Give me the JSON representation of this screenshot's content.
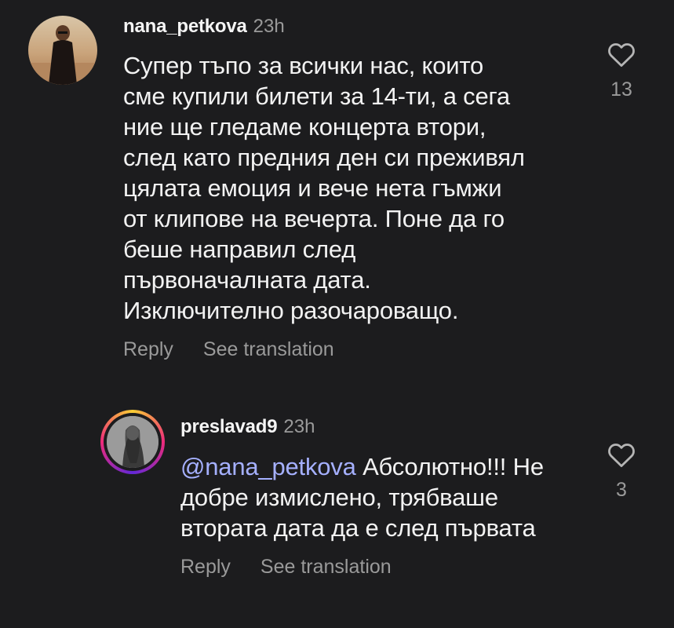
{
  "comments": [
    {
      "username": "nana_petkova",
      "time": "23h",
      "text": "Супер тъпо за всички нас, които\nсме купили билети за 14-ти, а сега\nние ще гледаме концерта втори,\nслед като предния ден си преживял\nцялата емоция и вече нета гъмжи\nот клипове на вечерта. Поне да го\nбеше направил след\nпървоначалната дата.\nИзключително разочароващо.",
      "reply_label": "Reply",
      "translate_label": "See translation",
      "likes": "13",
      "icon": "heart-outline-icon"
    },
    {
      "username": "preslavad9",
      "time": "23h",
      "mention": "@nana_petkova",
      "text": " Абсолютно!!! Не\nдобре измислено, трябваше\nвтората дата да е след първата",
      "reply_label": "Reply",
      "translate_label": "See translation",
      "likes": "3",
      "icon": "heart-outline-icon"
    }
  ],
  "colors": {
    "background": "#1c1c1e",
    "mention": "#a5b0ff",
    "muted": "#9a9a9a"
  }
}
